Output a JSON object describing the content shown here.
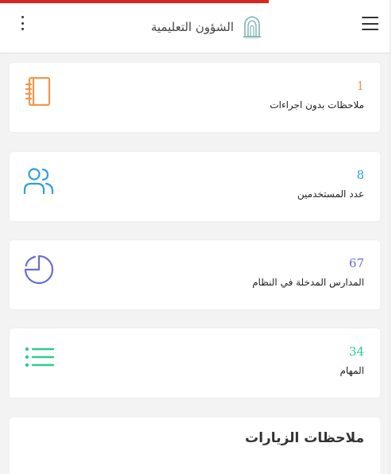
{
  "header": {
    "title": "الشؤون التعليمية",
    "logo_icon": "mosque-logo-icon",
    "menu_icon": "hamburger-icon",
    "more_icon": "more-vertical-icon"
  },
  "loader": {
    "color": "#d9251c",
    "progress": 0.69
  },
  "stats": [
    {
      "value": "1",
      "label": "ملاحظات بدون اجراءات",
      "icon": "notebook-icon",
      "color": "#f2964b"
    },
    {
      "value": "8",
      "label": "عدد المستخدمين",
      "icon": "users-icon",
      "color": "#2f9fe0"
    },
    {
      "value": "67",
      "label": "المدارس المدخلة في النظام",
      "icon": "pie-chart-icon",
      "color": "#6b6bd6"
    },
    {
      "value": "34",
      "label": "المهام",
      "icon": "list-icon",
      "color": "#2dcc8e"
    }
  ],
  "visits": {
    "title": "ملاحظات الزيارات"
  }
}
